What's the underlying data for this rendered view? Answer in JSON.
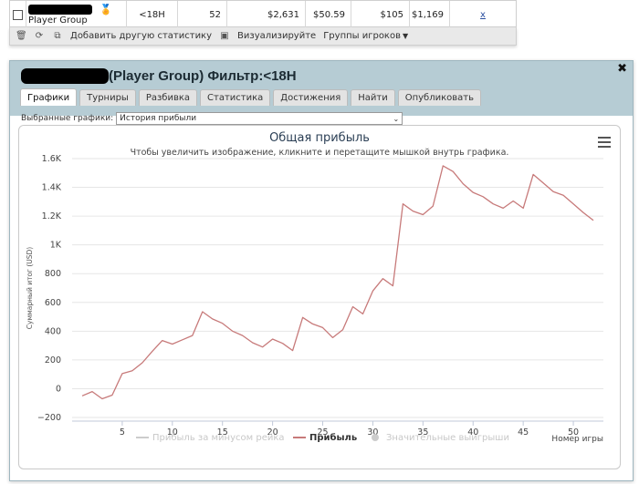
{
  "top_row": {
    "name_suffix": "Player Group",
    "stake": "<18H",
    "count": "52",
    "value1": "$2,631",
    "value2": "$50.59",
    "value3": "$105",
    "value4": "$1,169",
    "action": "x"
  },
  "toolbar": {
    "add_stats": "Добавить другую статистику",
    "visualize": "Визуализируйте",
    "player_groups": "Группы игроков"
  },
  "dialog": {
    "title": "(Player Group) Фильтр:<18H",
    "tabs": [
      "Графики",
      "Турниры",
      "Разбивка",
      "Статистика",
      "Достижения",
      "Найти",
      "Опубликовать"
    ],
    "selected_label": "Выбранные графики:",
    "selected_value": "История прибыли"
  },
  "chart_data": {
    "type": "line",
    "title": "Общая прибыль",
    "subtitle": "Чтобы увеличить изображение, кликните и перетащите мышкой внутрь графика.",
    "xlabel": "Номер игры",
    "ylabel": "Суммарный итог (USD)",
    "xlim": [
      0,
      53
    ],
    "ylim": [
      -200,
      1600
    ],
    "y_ticks": [
      {
        "value": -200,
        "label": "−200"
      },
      {
        "value": 0,
        "label": "0"
      },
      {
        "value": 200,
        "label": "200"
      },
      {
        "value": 400,
        "label": "400"
      },
      {
        "value": 600,
        "label": "600"
      },
      {
        "value": 800,
        "label": "800"
      },
      {
        "value": 1000,
        "label": "1K"
      },
      {
        "value": 1200,
        "label": "1.2K"
      },
      {
        "value": 1400,
        "label": "1.4K"
      },
      {
        "value": 1600,
        "label": "1.6K"
      }
    ],
    "x_ticks": [
      5,
      10,
      15,
      20,
      25,
      30,
      35,
      40,
      45,
      50
    ],
    "legend": [
      {
        "name": "Прибыль за минусом рейка",
        "color": "#cccccc",
        "marker": "line",
        "active": false
      },
      {
        "name": "Прибыль",
        "color": "#c77a7a",
        "marker": "line",
        "active": true
      },
      {
        "name": "Значительные выигрыши",
        "color": "#cccccc",
        "marker": "circle",
        "active": false
      }
    ],
    "series": [
      {
        "name": "Прибыль",
        "color": "#c77a7a",
        "x": [
          1,
          2,
          3,
          4,
          5,
          6,
          7,
          8,
          9,
          10,
          11,
          12,
          13,
          14,
          15,
          16,
          17,
          18,
          19,
          20,
          21,
          22,
          23,
          24,
          25,
          26,
          27,
          28,
          29,
          30,
          31,
          32,
          33,
          34,
          35,
          36,
          37,
          38,
          39,
          40,
          41,
          42,
          43,
          44,
          45,
          46,
          47,
          48,
          49,
          50,
          51,
          52
        ],
        "values": [
          -50,
          -20,
          -70,
          -45,
          105,
          125,
          180,
          260,
          335,
          310,
          340,
          370,
          535,
          485,
          455,
          400,
          370,
          320,
          290,
          345,
          315,
          265,
          495,
          450,
          425,
          355,
          410,
          570,
          520,
          680,
          765,
          715,
          1285,
          1235,
          1210,
          1270,
          1550,
          1510,
          1425,
          1365,
          1335,
          1285,
          1255,
          1305,
          1255,
          1490,
          1430,
          1370,
          1345,
          1285,
          1225,
          1170
        ]
      }
    ]
  }
}
